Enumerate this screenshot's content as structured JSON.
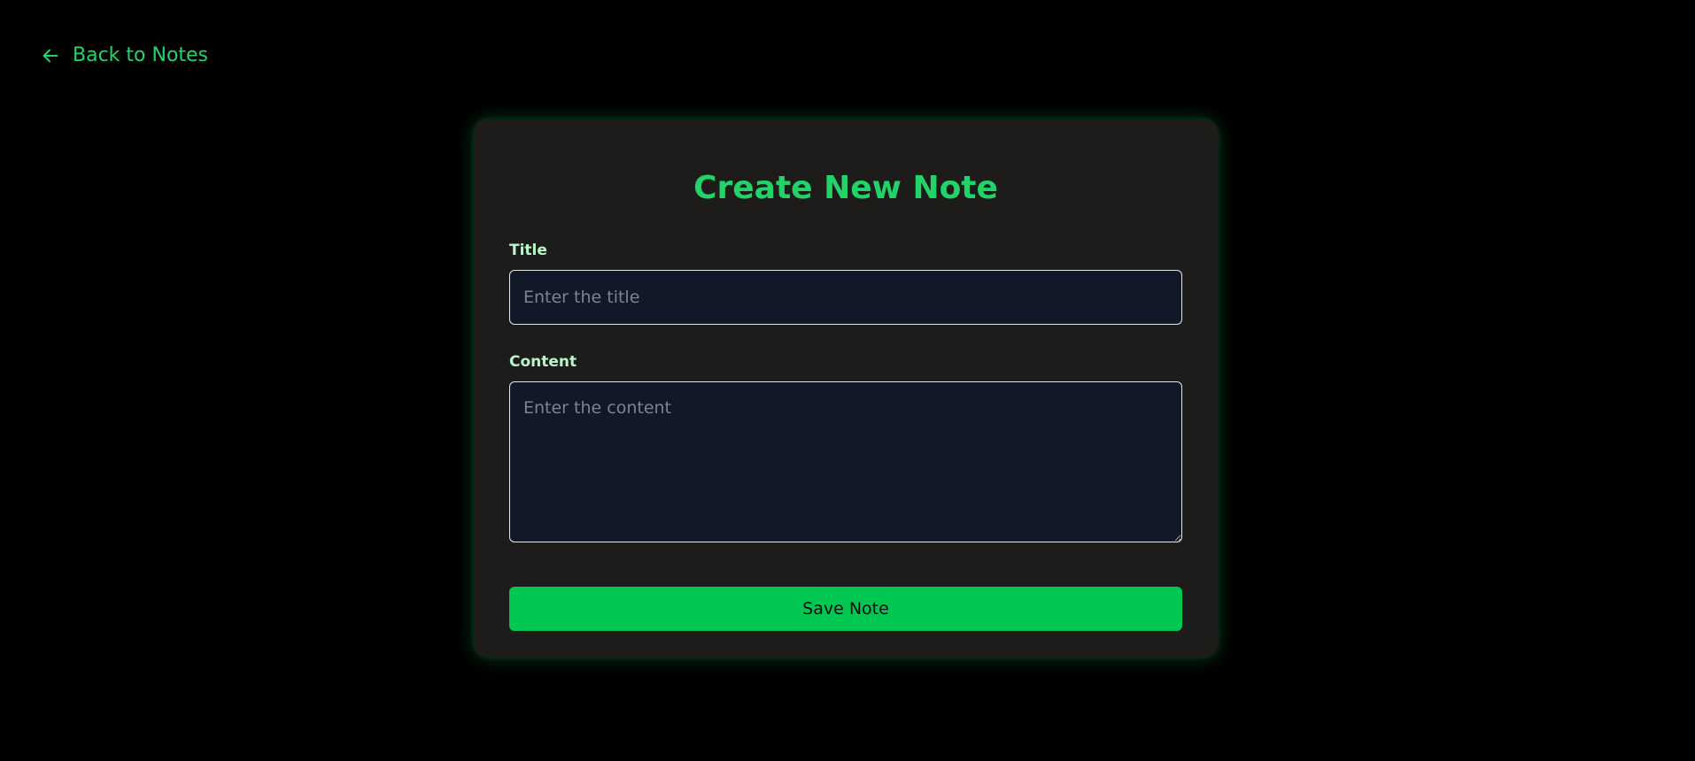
{
  "nav": {
    "back_label": "Back to Notes",
    "back_icon": "arrow-left-icon"
  },
  "form": {
    "heading": "Create New Note",
    "title_label": "Title",
    "title_placeholder": "Enter the title",
    "title_value": "",
    "content_label": "Content",
    "content_placeholder": "Enter the content",
    "content_value": "",
    "save_label": "Save Note"
  },
  "colors": {
    "background": "#000000",
    "card": "#1e1c1a",
    "accent": "#22d36a",
    "button": "#00c853",
    "input_bg": "#111827"
  }
}
